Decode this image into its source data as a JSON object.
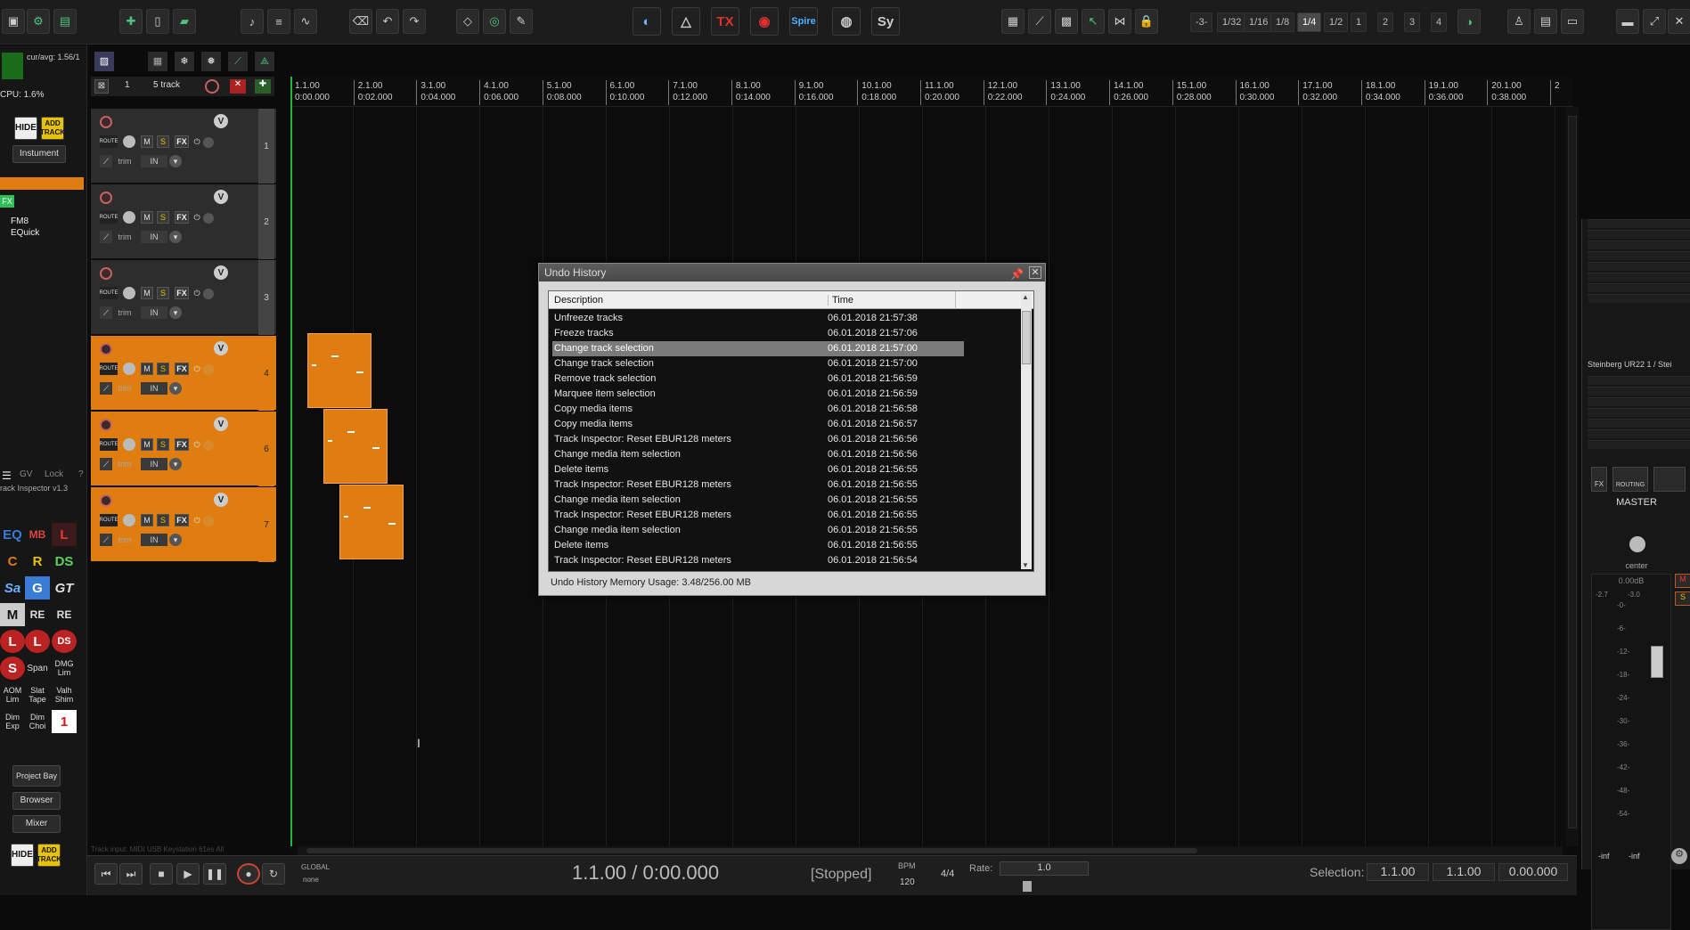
{
  "toolbar": {
    "plugins": [
      "TX",
      "Spire",
      "Sy"
    ],
    "grid_values": [
      "1/32",
      "1/16",
      "1/8",
      "1/4",
      "1/2",
      "1",
      "2",
      "3",
      "4"
    ],
    "grid_active": "1/4"
  },
  "left_panel": {
    "cpu_label": "cur/avg: 1.56/1",
    "cpu_value": "CPU: 1.6%",
    "hide_label": "HIDE",
    "add_track_label": "ADD TRACK",
    "instrument_label": "Instument",
    "fx_label": "FX",
    "fx_chain": [
      "FM8",
      "EQuick"
    ],
    "tabs": [
      "GV",
      "Lock",
      "?"
    ],
    "inspector_label": "rack Inspector v1.3",
    "plugin_grid": [
      "EQ",
      "MB",
      "L",
      "C",
      "R",
      "DS",
      "Sa",
      "G",
      "GT",
      "M",
      "RE",
      "RE",
      "L",
      "L",
      "DS",
      "S",
      "Span",
      "DMG Lim",
      "AOM Lim",
      "Slat Tape",
      "Valh Shim",
      "Dim Exp",
      "Dim Choi",
      "1"
    ],
    "project_bay_label": "Project Bay",
    "browser_label": "Browser",
    "mixer_label": "Mixer"
  },
  "track_controls": {
    "grid_num": "1",
    "track_count_label": "5 track"
  },
  "tracks": [
    {
      "num": "1",
      "selected": false
    },
    {
      "num": "2",
      "selected": false
    },
    {
      "num": "3",
      "selected": false
    },
    {
      "num": "4",
      "selected": true
    },
    {
      "num": "6",
      "selected": true
    },
    {
      "num": "7",
      "selected": true
    }
  ],
  "track_labels": {
    "route": "ROUTE",
    "m": "M",
    "s": "S",
    "fx": "FX",
    "trim": "trim",
    "in": "IN",
    "vol": "V"
  },
  "ruler": {
    "measures": [
      "1.1.00",
      "2.1.00",
      "3.1.00",
      "4.1.00",
      "5.1.00",
      "6.1.00",
      "7.1.00",
      "8.1.00",
      "9.1.00",
      "10.1.00",
      "11.1.00",
      "12.1.00",
      "13.1.00",
      "14.1.00",
      "15.1.00",
      "16.1.00",
      "17.1.00",
      "18.1.00",
      "19.1.00",
      "20.1.00",
      "2"
    ],
    "times": [
      "0:00.000",
      "0:02.000",
      "0:04.000",
      "0:06.000",
      "0:08.000",
      "0:10.000",
      "0:12.000",
      "0:14.000",
      "0:16.000",
      "0:18.000",
      "0:20.000",
      "0:22.000",
      "0:24.000",
      "0:26.000",
      "0:28.000",
      "0:30.000",
      "0:32.000",
      "0:34.000",
      "0:36.000",
      "0:38.000",
      ""
    ]
  },
  "undo_history": {
    "title": "Undo History",
    "col_description": "Description",
    "col_time": "Time",
    "rows": [
      {
        "desc": "Unfreeze tracks",
        "time": "06.01.2018 21:57:38",
        "selected": false
      },
      {
        "desc": "Freeze tracks",
        "time": "06.01.2018 21:57:06",
        "selected": false
      },
      {
        "desc": "Change track selection",
        "time": "06.01.2018 21:57:00",
        "selected": true
      },
      {
        "desc": "Change track selection",
        "time": "06.01.2018 21:57:00",
        "selected": false
      },
      {
        "desc": "Remove track selection",
        "time": "06.01.2018 21:56:59",
        "selected": false
      },
      {
        "desc": "Marquee item selection",
        "time": "06.01.2018 21:56:59",
        "selected": false
      },
      {
        "desc": "Copy media items",
        "time": "06.01.2018 21:56:58",
        "selected": false
      },
      {
        "desc": "Copy media items",
        "time": "06.01.2018 21:56:57",
        "selected": false
      },
      {
        "desc": "Track Inspector: Reset EBUR128 meters",
        "time": "06.01.2018 21:56:56",
        "selected": false
      },
      {
        "desc": "Change media item selection",
        "time": "06.01.2018 21:56:56",
        "selected": false
      },
      {
        "desc": "Delete items",
        "time": "06.01.2018 21:56:55",
        "selected": false
      },
      {
        "desc": "Track Inspector: Reset EBUR128 meters",
        "time": "06.01.2018 21:56:55",
        "selected": false
      },
      {
        "desc": "Change media item selection",
        "time": "06.01.2018 21:56:55",
        "selected": false
      },
      {
        "desc": "Track Inspector: Reset EBUR128 meters",
        "time": "06.01.2018 21:56:55",
        "selected": false
      },
      {
        "desc": "Change media item selection",
        "time": "06.01.2018 21:56:55",
        "selected": false
      },
      {
        "desc": "Delete items",
        "time": "06.01.2018 21:56:55",
        "selected": false
      },
      {
        "desc": "Track Inspector: Reset EBUR128 meters",
        "time": "06.01.2018 21:56:54",
        "selected": false
      }
    ],
    "footer": "Undo History Memory Usage: 3.48/256.00 MB"
  },
  "mixer": {
    "device": "Steinberg UR22 1 / Stei",
    "fx_label": "FX",
    "routing_label": "ROUTING",
    "master_label": "MASTER",
    "pan_label": "center",
    "db_readout": "0.00dB",
    "peak_left": "-2.7",
    "peak_right": "-3.0",
    "scale": [
      "-0-",
      "-6-",
      "-12-",
      "-18-",
      "-24-",
      "-30-",
      "-36-",
      "-42-",
      "-48-",
      "-54-"
    ],
    "inf_left": "-inf",
    "inf_right": "-inf"
  },
  "transport": {
    "global_label": "GLOBAL",
    "none_label": "none",
    "position": "1.1.00 / 0:00.000",
    "state": "[Stopped]",
    "bpm_label": "BPM",
    "bpm_value": "120",
    "time_sig": "4/4",
    "rate_label": "Rate:",
    "rate_value": "1.0",
    "selection_label": "Selection:",
    "sel_start": "1.1.00",
    "sel_end": "1.1.00",
    "sel_length": "0.00.000"
  },
  "status_text": "Track input: MIDI USB Keystation 61es All"
}
